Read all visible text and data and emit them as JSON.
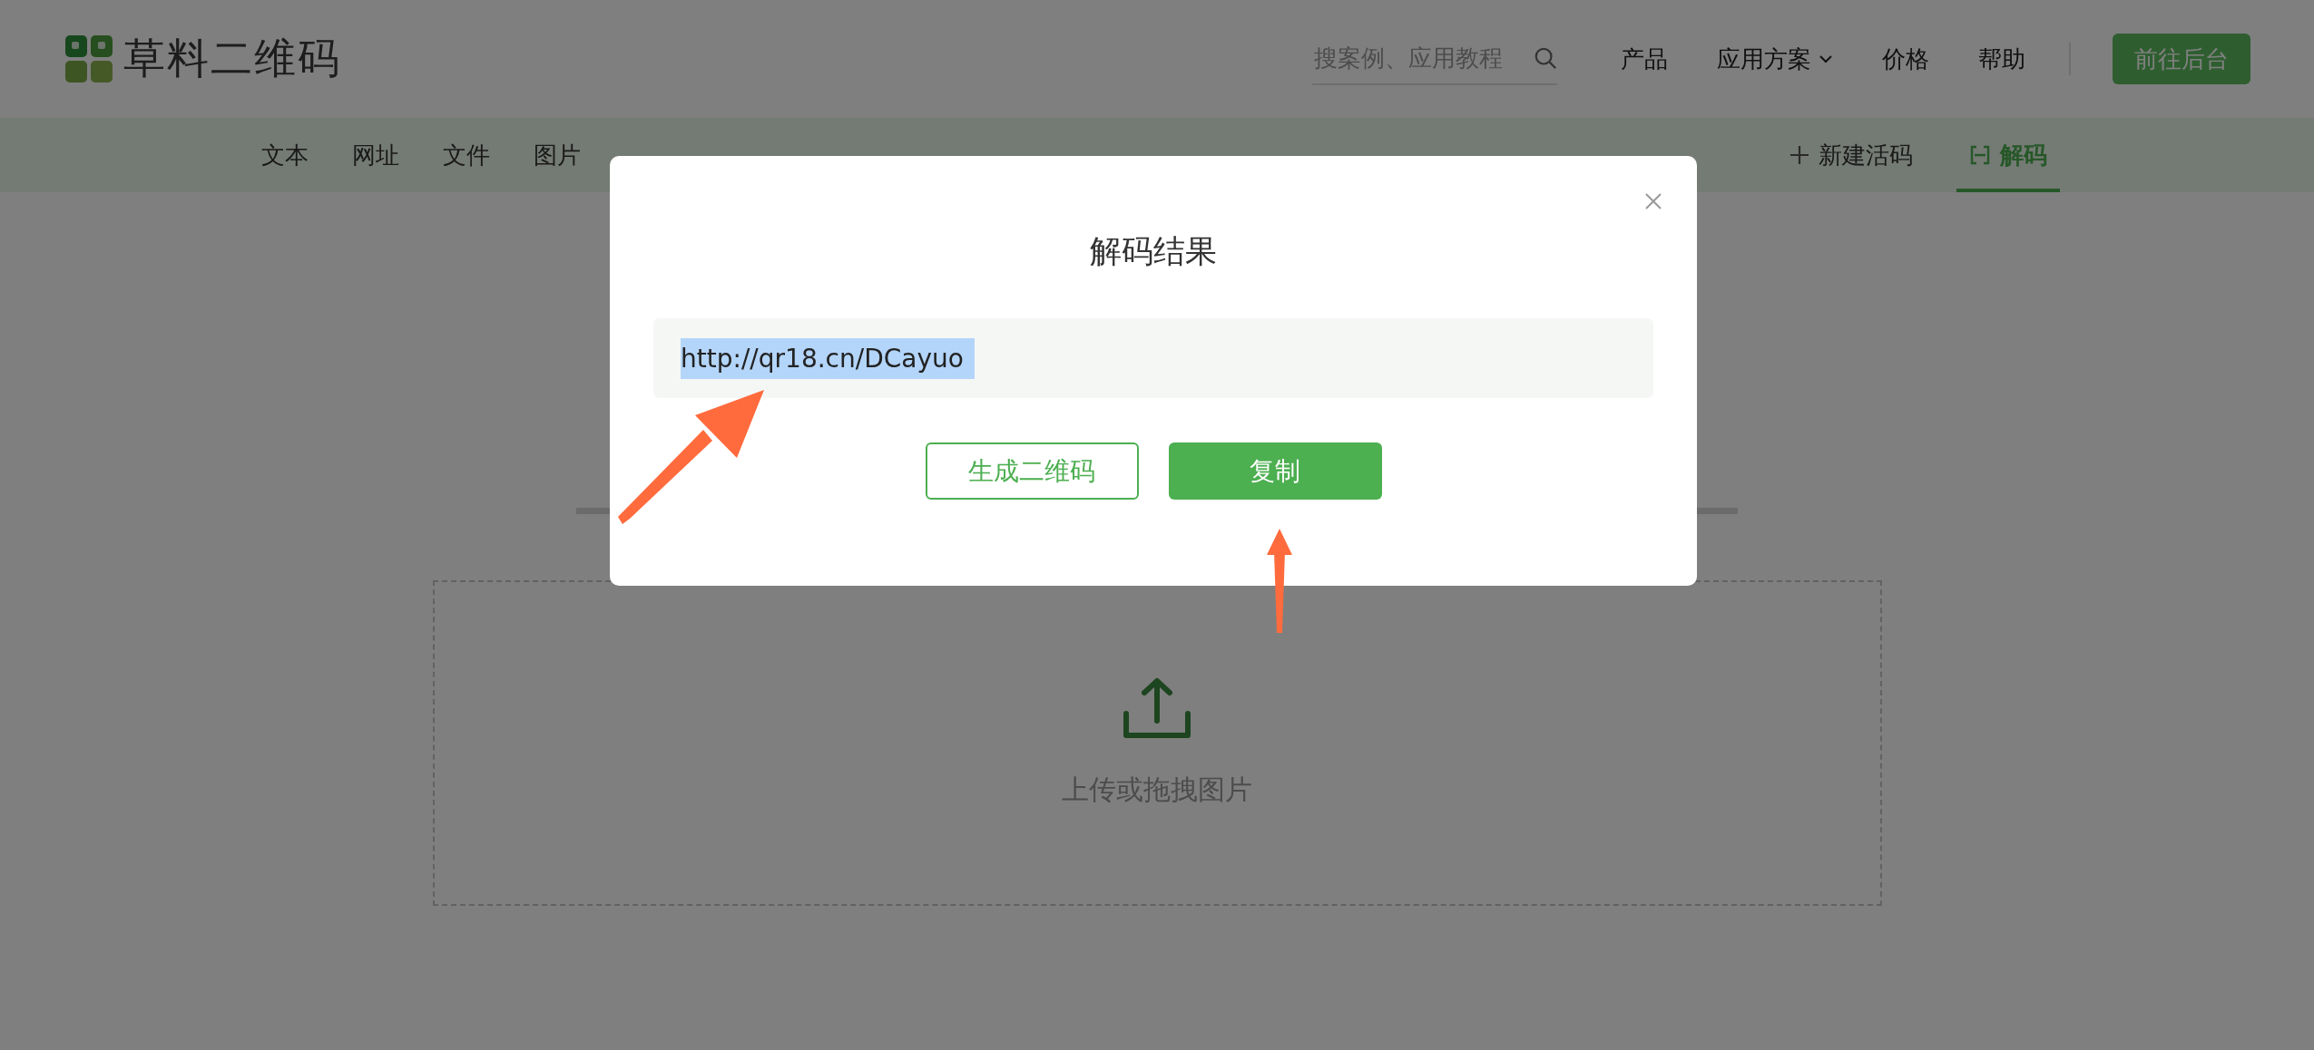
{
  "logo": {
    "text": "草料二维码"
  },
  "search": {
    "placeholder": "搜案例、应用教程"
  },
  "top_nav": [
    {
      "label": "产品",
      "kind": "link"
    },
    {
      "label": "应用方案",
      "kind": "dropdown"
    },
    {
      "label": "价格",
      "kind": "link"
    },
    {
      "label": "帮助",
      "kind": "link"
    }
  ],
  "admin_button": {
    "label": "前往后台"
  },
  "categories": [
    {
      "label": "文本"
    },
    {
      "label": "网址"
    },
    {
      "label": "文件"
    },
    {
      "label": "图片"
    }
  ],
  "actions": [
    {
      "label": "新建活码",
      "kind": "add",
      "selected": false
    },
    {
      "label": "解码",
      "kind": "scan",
      "selected": true
    }
  ],
  "upload": {
    "label": "上传或拖拽图片"
  },
  "dialog": {
    "title": "解码结果",
    "result": "http://qr18.cn/DCayuo",
    "result_selected": true,
    "buttons": [
      {
        "label": "生成二维码",
        "kind": "outline"
      },
      {
        "label": "复制",
        "kind": "primary"
      }
    ]
  }
}
